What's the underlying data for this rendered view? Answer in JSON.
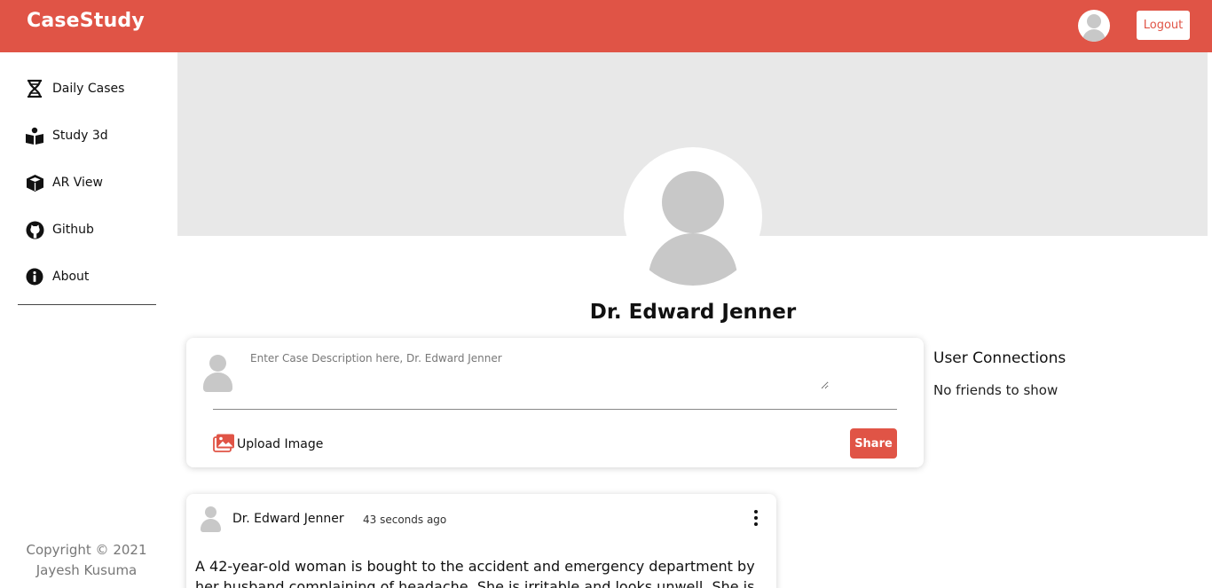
{
  "app": {
    "title": "CaseStudy"
  },
  "header": {
    "logout_label": "Logout"
  },
  "sidebar": {
    "items": [
      {
        "label": "Daily Cases",
        "icon": "dna-icon"
      },
      {
        "label": "Study 3d",
        "icon": "study-book-icon"
      },
      {
        "label": "AR View",
        "icon": "cube-icon"
      },
      {
        "label": "Github",
        "icon": "github-icon"
      },
      {
        "label": "About",
        "icon": "info-icon"
      }
    ],
    "copyright_line1": "Copyright © 2021",
    "copyright_line2": "Jayesh Kusuma"
  },
  "profile": {
    "name": "Dr. Edward Jenner"
  },
  "post_box": {
    "placeholder": "Enter Case Description here, Dr. Edward Jenner",
    "upload_label": "Upload Image",
    "share_label": "Share"
  },
  "connections": {
    "title": "User Connections",
    "empty_text": "No friends to show"
  },
  "feed": [
    {
      "author": "Dr. Edward Jenner",
      "time": "43 seconds ago",
      "text": "A 42-year-old woman is bought to the accident and emergency department by her husband complaining of headache. She is irritable and looks unwell. She is"
    }
  ],
  "colors": {
    "brand": "#e05446",
    "cover": "#e8e8e8",
    "avatar_placeholder": "#c8c8c8"
  }
}
